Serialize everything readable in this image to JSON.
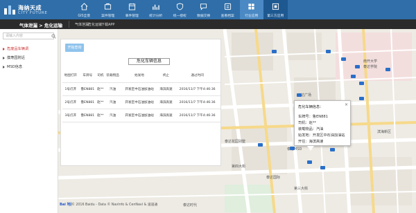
{
  "app": {
    "name_zh": "海纳天成",
    "name_en": "CITY FUTURE"
  },
  "nav": [
    {
      "label": "GIS全景",
      "icon": "home-icon"
    },
    {
      "label": "案件管理",
      "icon": "case-icon"
    },
    {
      "label": "事件管理",
      "icon": "event-icon"
    },
    {
      "label": "统计分析",
      "icon": "chart-icon"
    },
    {
      "label": "统一授权",
      "icon": "shield-icon"
    },
    {
      "label": "数据交换",
      "icon": "chat-icon"
    },
    {
      "label": "查看档案",
      "icon": "archive-icon"
    },
    {
      "label": "行业应用",
      "icon": "grid-icon"
    },
    {
      "label": "第三方应用",
      "icon": "app-icon"
    }
  ],
  "breadcrumb": {
    "main": "气体泄漏 > 危化运输",
    "subs": [
      "气体泄漏",
      "危化运输",
      "下载APP"
    ]
  },
  "sidebar": {
    "search_placeholder": "请输入内容",
    "items": [
      "危废品车辆调",
      "摸寿园附近",
      "MSD信息"
    ]
  },
  "panel": {
    "query_button": "开始查询",
    "title": "危化车辆信息",
    "columns": [
      "地图打开",
      "车牌号",
      "司机",
      "装载物品",
      "始发地",
      "终止",
      "通过时间"
    ],
    "rows": [
      [
        "1号灯开",
        "鲁EN881",
        "赵**",
        "汽油",
        "开发区中石油加油站",
        "海滨高速",
        "2016/11/7 下午4:46:36"
      ],
      [
        "2号灯开",
        "鲁EN881",
        "赵**",
        "汽油",
        "开发区中石油加油站",
        "海滨高速",
        "2016/11/7 下午4:46:36"
      ],
      [
        "3号灯开",
        "鲁EN881",
        "赵**",
        "汽油",
        "开发区中石油加油站",
        "海滨高速",
        "2016/11/7 下午4:46:36"
      ]
    ]
  },
  "popup": {
    "title": "危化车辆信息：",
    "close": "×",
    "plate": "车牌号：鲁EN881",
    "driver": "司机：赵**",
    "cargo": "装载物品：汽油",
    "origin": "始发地：开发区中石油加油站",
    "dest": "开往：海滨高速"
  },
  "map": {
    "copyright": "© 2016 Baidu - Data © NavInfo & CenNavi & 道道通",
    "logo": "Bai 地图",
    "labels": [
      "南开大学",
      "泰达学院",
      "泰达广场",
      "泰达MSD",
      "泰达花园别墅",
      "泰达时代",
      "泰达国际",
      "第四大街",
      "第三大街",
      "滨海新区"
    ]
  },
  "colors": {
    "topbar": "#2f6ea8",
    "crumbbar": "#2b2b2b",
    "marker": "#2a6fc9",
    "button": "#8fc3ec"
  }
}
